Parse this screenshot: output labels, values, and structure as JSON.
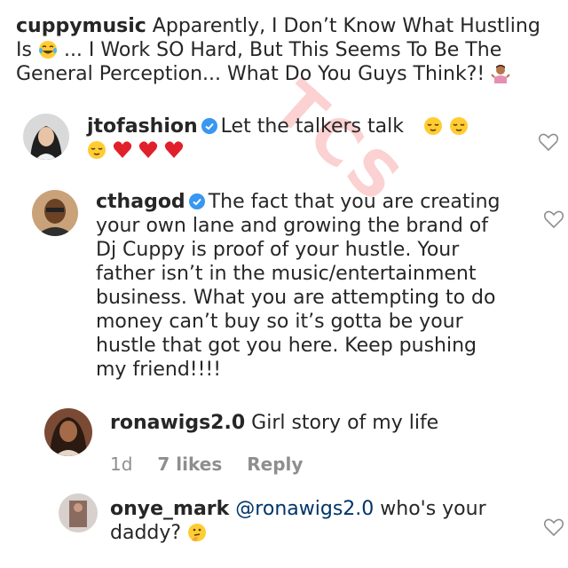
{
  "caption": {
    "username": "cuppymusic",
    "text_1": " Apparently, I Don’t Know What Hustling Is ",
    "text_2": " ... I Work SO Hard, But This Seems To Be The General Perception... What Do You Guys Think?! "
  },
  "watermark": "TCS",
  "comments": [
    {
      "username": "jtofashion",
      "verified": true,
      "text": "Let the talkers talk",
      "emoji_icons": [
        "relieved-face",
        "relieved-face",
        "relieved-face",
        "red-heart",
        "red-heart",
        "red-heart"
      ]
    },
    {
      "username": "cthagod",
      "verified": true,
      "text": "The fact that you are creating your own lane and growing the brand of Dj Cuppy is proof of your hustle. Your father isn’t in the music/entertainment business. What you are attempting to do money can’t buy so it’s gotta be your hustle that got you here. Keep pushing my friend!!!!"
    },
    {
      "username": "ronawigs2.0",
      "verified": false,
      "text": "Girl story of my life",
      "time": "1d",
      "likes": "7 likes",
      "reply": "Reply"
    },
    {
      "username": "onye_mark",
      "verified": false,
      "mention": "@ronawigs2.0",
      "text": " who's your daddy? ",
      "emoji_icons": [
        "thinking-face"
      ]
    }
  ],
  "colors": {
    "text": "#262626",
    "meta": "#8e8e8e",
    "verified": "#3897f0",
    "mention": "#003569",
    "heart_outline": "#8e8e8e"
  }
}
